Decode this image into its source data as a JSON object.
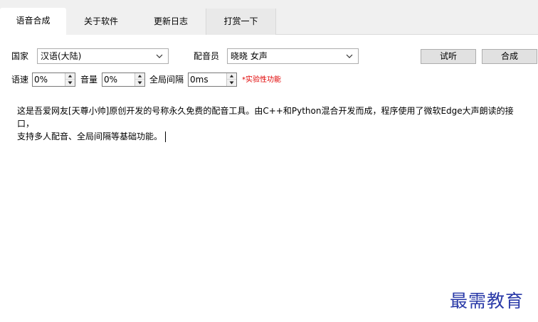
{
  "tabs": [
    {
      "label": "语音合成",
      "active": true
    },
    {
      "label": "关于软件",
      "active": false
    },
    {
      "label": "更新日志",
      "active": false
    },
    {
      "label": "打赏一下",
      "active": false
    }
  ],
  "row1": {
    "country_label": "国家",
    "country_value": "汉语(大陆)",
    "voice_label": "配音员",
    "voice_value": "晓晓 女声",
    "try_button": "试听",
    "synth_button": "合成"
  },
  "row2": {
    "speed_label": "语速",
    "speed_value": "0%",
    "volume_label": "音量",
    "volume_value": "0%",
    "interval_label": "全局间隔",
    "interval_value": "0ms",
    "experimental_note": "*实验性功能"
  },
  "content": {
    "line1": "这是吾爱网友[天尊小帅]原创开发的号称永久免费的配音工具。由C++和Python混合开发而成，程序使用了微软Edge大声朗读的接口，",
    "line2": "支持多人配音、全局间隔等基础功能。"
  },
  "watermark": "最需教育",
  "colors": {
    "note": "#e00000",
    "watermark": "#2a3aa8"
  },
  "icons": {
    "select_arrow": "chevron-down-icon",
    "spin_up": "triangle-up-icon",
    "spin_down": "triangle-down-icon"
  }
}
